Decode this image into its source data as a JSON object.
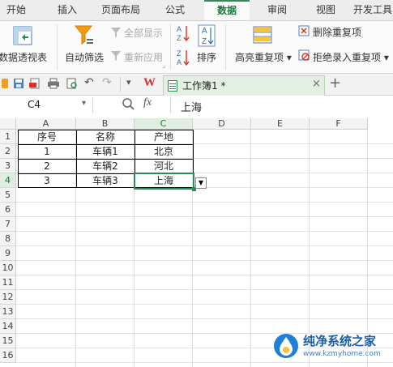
{
  "menu": {
    "tabs": [
      "开始",
      "插入",
      "页面布局",
      "公式",
      "数据",
      "审阅",
      "视图",
      "开发工具"
    ],
    "active": "数据"
  },
  "ribbon": {
    "pivot": "数据透视表",
    "autofilter": "自动筛选",
    "show_all": "全部显示",
    "reapply": "重新应用",
    "sort": "排序",
    "highlight_dup": "高亮重复项",
    "remove_dup": "删除重复项",
    "reject_dup": "拒绝录入重复项"
  },
  "doc_tab": {
    "title": "工作簿1 *"
  },
  "formula_bar": {
    "cell_ref": "C4",
    "fx": "fx",
    "value": "上海"
  },
  "columns": [
    "A",
    "B",
    "C",
    "D",
    "E",
    "F"
  ],
  "rows": [
    "1",
    "2",
    "3",
    "4",
    "5",
    "6",
    "7",
    "8",
    "9",
    "10",
    "11",
    "12",
    "13",
    "14",
    "15",
    "16"
  ],
  "table": {
    "header": [
      "序号",
      "名称",
      "产地"
    ],
    "rows": [
      [
        "1",
        "车辆1",
        "北京"
      ],
      [
        "2",
        "车辆2",
        "河北"
      ],
      [
        "3",
        "车辆3",
        "上海"
      ]
    ]
  },
  "watermark": {
    "name": "纯净系统之家",
    "url": "www.kzmyhome.com"
  },
  "colors": {
    "accent": "#2e8b57",
    "wps_red": "#d9322c",
    "funnel": "#f39c12"
  }
}
